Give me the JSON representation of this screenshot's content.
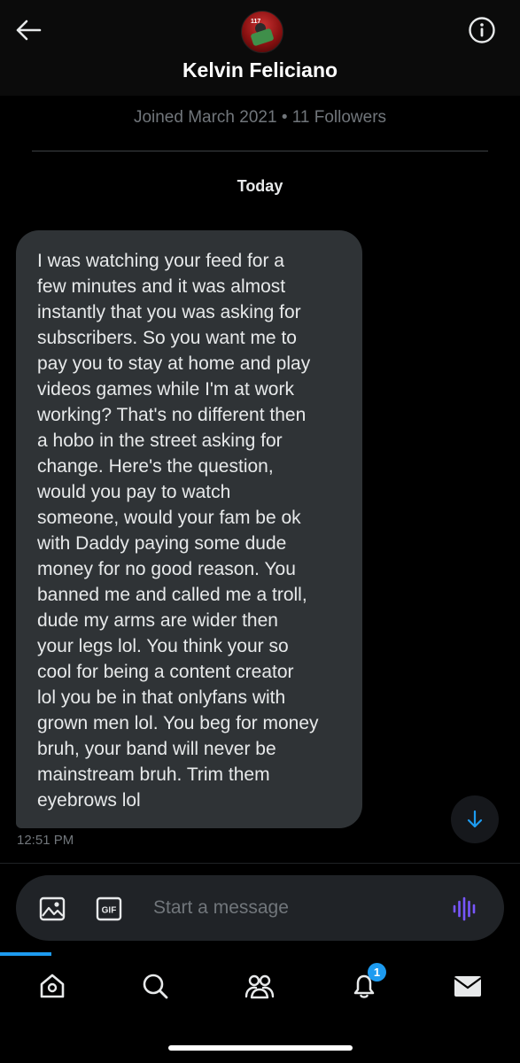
{
  "header": {
    "avatar_badge": "117",
    "name": "Kelvin Feliciano",
    "joined": "Joined March 2021 • 11 Followers"
  },
  "conversation": {
    "date_label": "Today",
    "messages": [
      {
        "text": "I was watching your feed for a\nfew minutes and it was almost\ninstantly that you was asking for\nsubscribers. So you want me to\npay you to stay at home and play\nvideos games while I'm at work\nworking? That's no different then\na hobo in the street asking for\nchange. Here's the question,\nwould you pay to watch\nsomeone, would your fam be ok\nwith Daddy paying some dude\nmoney for no good reason. You\nbanned me and called me a troll,\ndude my arms are wider then\nyour legs lol. You think your so\ncool for being a content creator\nlol you be in that onlyfans with\ngrown men lol. You beg for money\nbruh, your band will never be\nmainstream bruh. Trim them\neyebrows lol",
        "time": "12:51 PM"
      }
    ]
  },
  "composer": {
    "placeholder": "Start a message",
    "gif_label": "GIF"
  },
  "tabs": [
    {
      "name": "home",
      "icon": "home-icon"
    },
    {
      "name": "search",
      "icon": "search-icon"
    },
    {
      "name": "communities",
      "icon": "communities-icon"
    },
    {
      "name": "notifications",
      "icon": "bell-icon",
      "badge": "1"
    },
    {
      "name": "messages",
      "icon": "mail-icon"
    }
  ],
  "colors": {
    "accent": "#1d9bf0",
    "bubble": "#2f3336",
    "voice": "#7856ff"
  }
}
